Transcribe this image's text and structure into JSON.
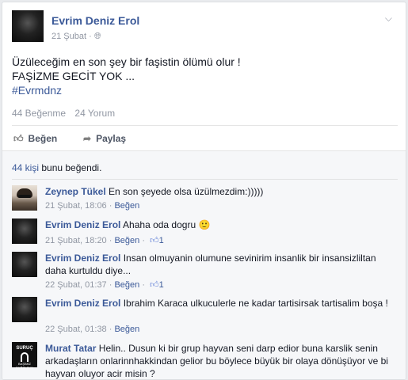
{
  "post": {
    "author": "Evrim Deniz Erol",
    "date": "21 Şubat",
    "privacy_icon": "globe-icon",
    "lines": [
      "Üzüleceğim en son şey bir faşistin ölümü olur !",
      "FAŞİZME GECİT YOK ..."
    ],
    "hashtag": "#Evrmdnz",
    "likes_count": "44 Beğenme",
    "comments_count": "24 Yorum"
  },
  "actions": {
    "like": "Beğen",
    "share": "Paylaş"
  },
  "likes_summary": {
    "link": "44 kişi",
    "rest": " bunu beğendi."
  },
  "comments": [
    {
      "name": "Zeynep Tükel",
      "text": " En son şeyede olsa üzülmezdim:)))))",
      "date": "21 Şubat, 18:06",
      "like": "Beğen",
      "likes": ""
    },
    {
      "name": "Evrim Deniz Erol",
      "text": " Ahaha oda dogru 🙂",
      "date": "21 Şubat, 18:20",
      "like": "Beğen",
      "likes": "1"
    },
    {
      "name": "Evrim Deniz Erol",
      "text": " Insan olmuyanin olumune sevinirim insanlik bir insansizliltan daha kurtuldu diye...",
      "date": "22 Şubat, 01:37",
      "like": "Beğen",
      "likes": "1"
    },
    {
      "name": "Evrim Deniz Erol",
      "text": " Ibrahim Karaca ulkuculerle ne kadar tartisirsak tartisalim boşa !",
      "date": "22 Şubat, 01:38",
      "like": "Beğen",
      "likes": ""
    },
    {
      "name": "Murat Tatar",
      "text": " Helin.. Dusun ki bir grup hayvan seni darp edior buna karslik senin arkadaşların onlarinnhakkindan gelior bu böylece büyük bir olaya dönüşüyor ve bi hayvan oluyor acir misin ?",
      "date": "",
      "like": "",
      "likes": ""
    }
  ],
  "murat_avatar": {
    "title": "SURUÇ",
    "subtitle": "BAŞIMIZ SAĞOLSUN"
  },
  "separator": " · "
}
